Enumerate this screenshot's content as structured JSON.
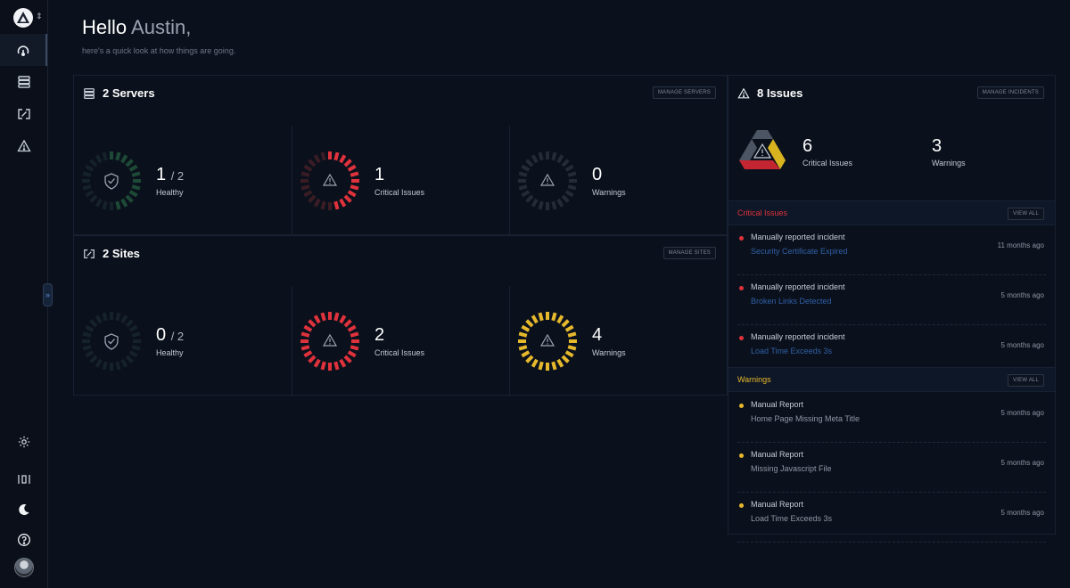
{
  "greeting": {
    "hello": "Hello",
    "name": "Austin,",
    "subtitle": "here's a quick look at how things are going."
  },
  "servers": {
    "title": "2 Servers",
    "manage_label": "MANAGE SERVERS",
    "stats": [
      {
        "value": "1",
        "of": "/ 2",
        "label": "Healthy",
        "kind": "healthy",
        "fill": 0.5
      },
      {
        "value": "1",
        "of": "",
        "label": "Critical Issues",
        "kind": "critical",
        "fill": 0.5
      },
      {
        "value": "0",
        "of": "",
        "label": "Warnings",
        "kind": "warning",
        "fill": 0
      }
    ]
  },
  "sites": {
    "title": "2 Sites",
    "manage_label": "MANAGE SITES",
    "stats": [
      {
        "value": "0",
        "of": "/ 2",
        "label": "Healthy",
        "kind": "healthy",
        "fill": 0
      },
      {
        "value": "2",
        "of": "",
        "label": "Critical Issues",
        "kind": "critical",
        "fill": 1
      },
      {
        "value": "4",
        "of": "",
        "label": "Warnings",
        "kind": "warning",
        "fill": 1
      }
    ]
  },
  "issues": {
    "title": "8 Issues",
    "manage_label": "MANAGE INCIDENTS",
    "critical_count": "6",
    "critical_label": "Critical Issues",
    "warning_count": "3",
    "warning_label": "Warnings",
    "critical_section": {
      "title": "Critical Issues",
      "view_all": "VIEW ALL",
      "items": [
        {
          "title": "Manually reported incident",
          "sub": "Security Certificate Expired",
          "time": "11 months ago"
        },
        {
          "title": "Manually reported incident",
          "sub": "Broken Links Detected",
          "time": "5 months ago"
        },
        {
          "title": "Manually reported incident",
          "sub": "Load Time Exceeds 3s",
          "time": "5 months ago"
        }
      ]
    },
    "warning_section": {
      "title": "Warnings",
      "view_all": "VIEW ALL",
      "items": [
        {
          "title": "Manual Report",
          "sub": "Home Page Missing Meta Title",
          "time": "5 months ago"
        },
        {
          "title": "Manual Report",
          "sub": "Missing Javascript File",
          "time": "5 months ago"
        },
        {
          "title": "Manual Report",
          "sub": "Load Time Exceeds 3s",
          "time": "5 months ago"
        }
      ]
    }
  },
  "sidebar": {
    "icons": [
      "logo-icon",
      "dashboard-icon",
      "servers-icon",
      "sites-icon",
      "issues-icon",
      "settings-icon",
      "layout-icon",
      "dark-mode-icon",
      "help-icon"
    ]
  },
  "colors": {
    "healthy": "#1d4a36",
    "healthy_dim": "#16222b",
    "critical": "#e0323c",
    "critical_dim": "#3a1c24",
    "warning": "#e6b82c",
    "warning_dim": "#242b36",
    "crit_text": "#e0323c",
    "warn_text": "#e6b82c",
    "link_blue": "#2f5fa6"
  }
}
